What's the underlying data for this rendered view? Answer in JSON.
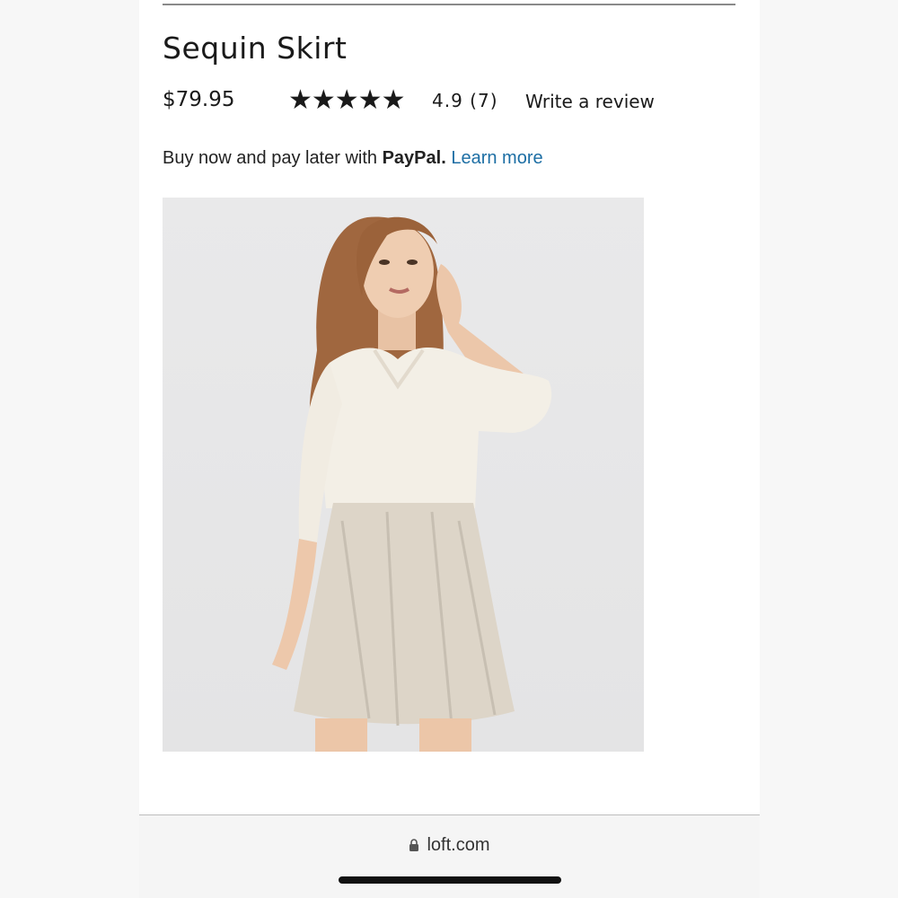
{
  "product": {
    "title": "Sequin Skirt",
    "price": "$79.95",
    "stars": "★★★★★",
    "rating": "4.9 (7)",
    "write_review": "Write a review"
  },
  "paypal": {
    "prefix": "Buy now and pay later with ",
    "brand": "PayPal.",
    "link": "Learn more"
  },
  "footer": {
    "url": "loft.com"
  },
  "rating_value": 4.9,
  "review_count": 7
}
